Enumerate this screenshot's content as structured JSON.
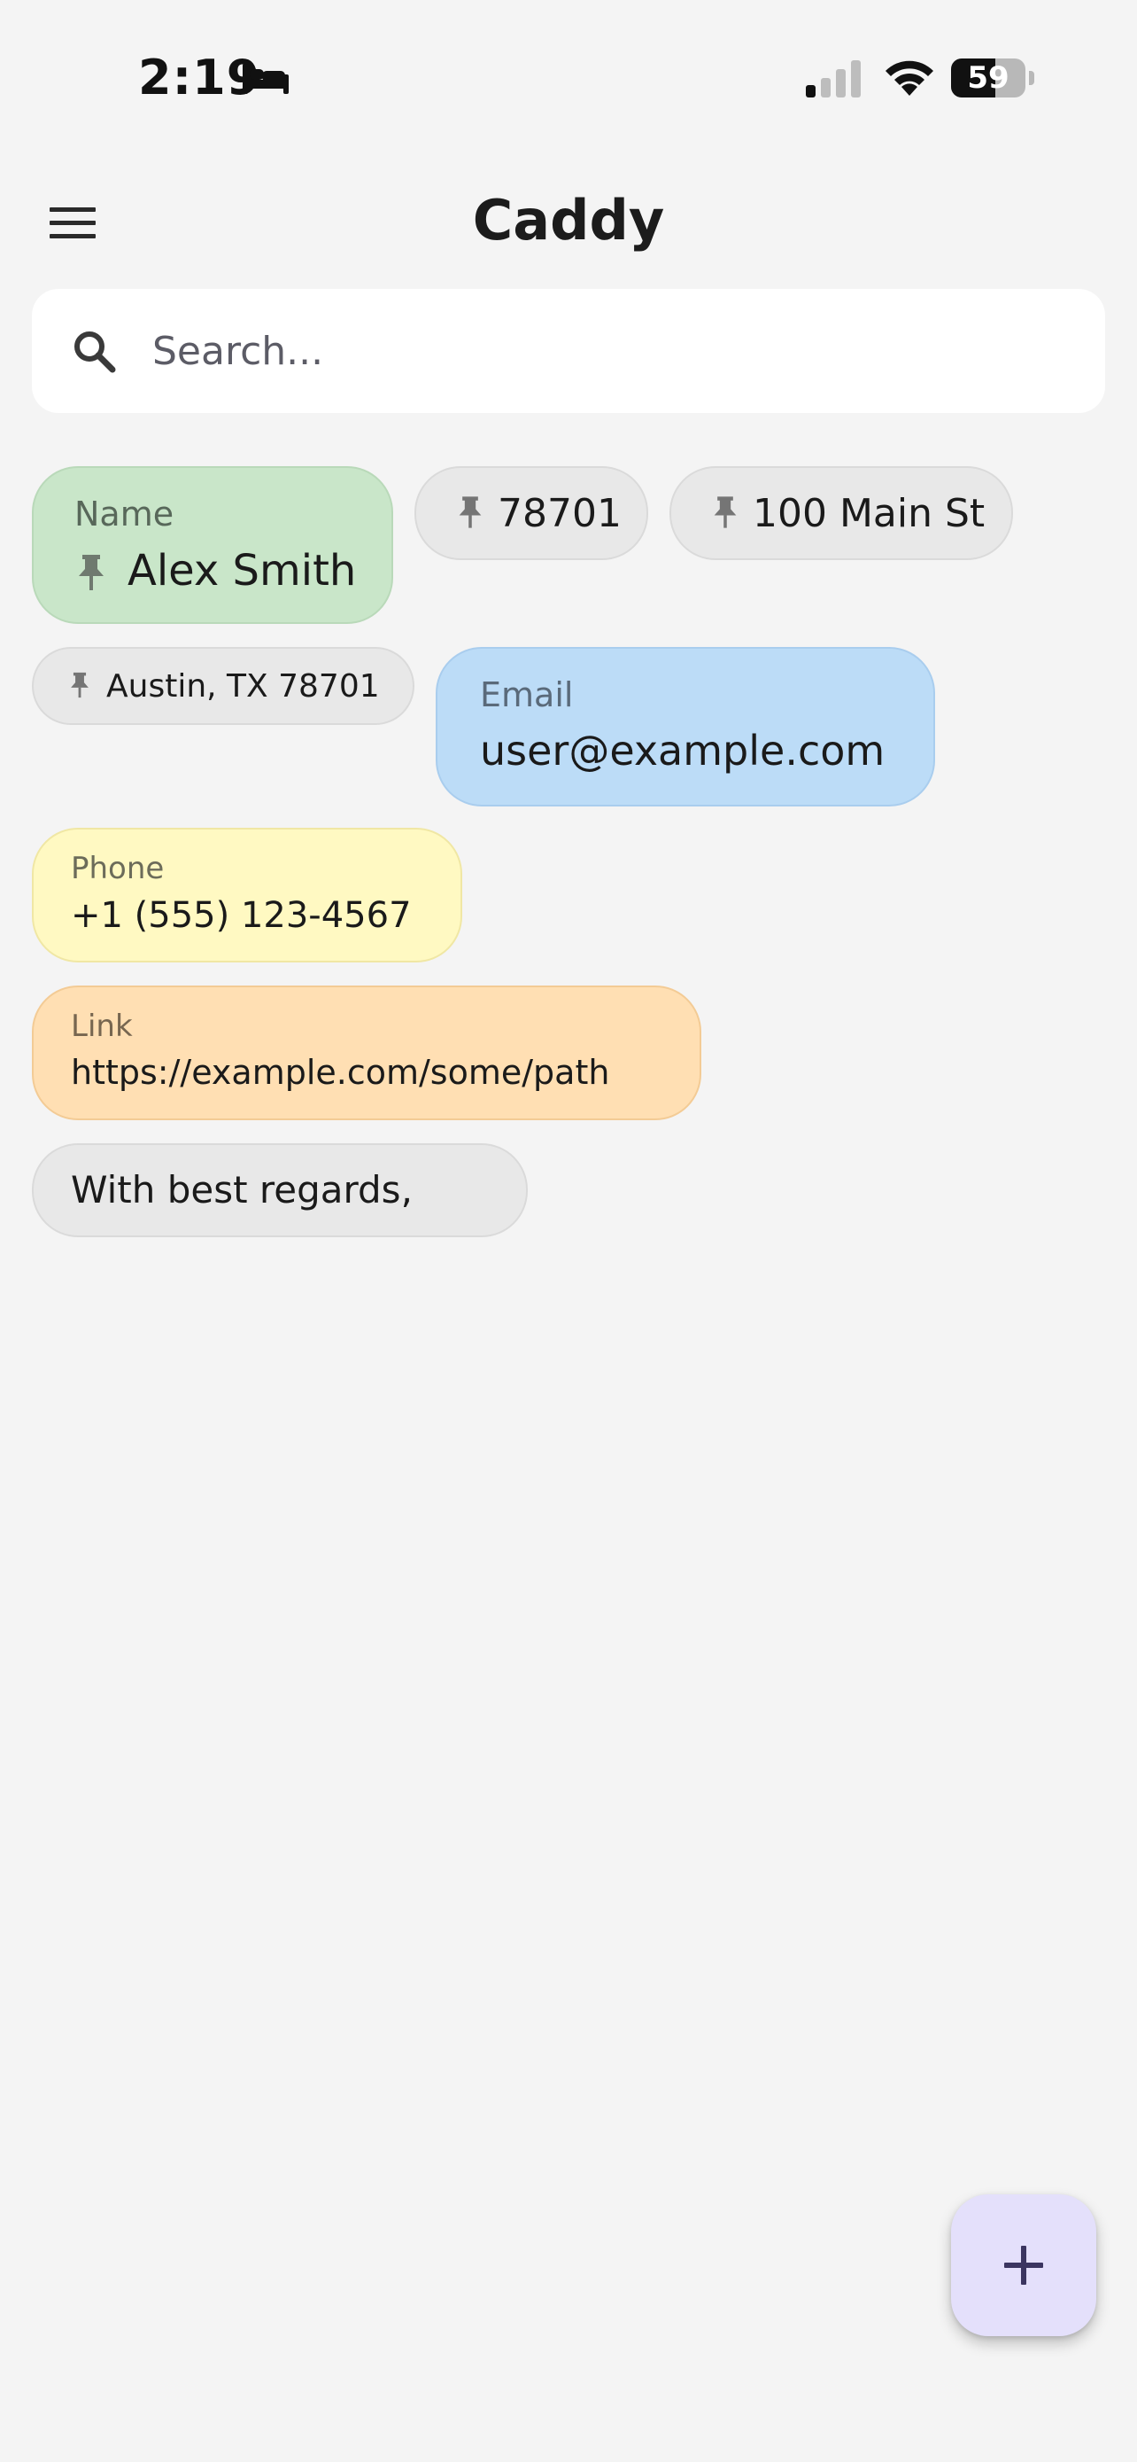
{
  "status_bar": {
    "time": "2:19",
    "battery_percent": 59,
    "battery_text": "59",
    "signal_bars_active": 1,
    "signal_bars_total": 4
  },
  "app_bar": {
    "title": "Caddy",
    "menu_icon": "hamburger-menu-icon"
  },
  "search": {
    "placeholder": "Search...",
    "value": "",
    "icon": "search-icon"
  },
  "chips": {
    "name": {
      "label": "Name",
      "value": "Alex Smith",
      "pinned": true,
      "color": "#c9e6c9"
    },
    "zip": {
      "value": "78701",
      "pinned": true,
      "color": "#e8e8e8"
    },
    "street": {
      "value": "100 Main St",
      "pinned": true,
      "color": "#e8e8e8"
    },
    "city": {
      "value": "Austin, TX 78701",
      "pinned": true,
      "color": "#e8e8e8"
    },
    "email": {
      "label": "Email",
      "value": "user@example.com",
      "color": "#bcdcf7"
    },
    "phone": {
      "label": "Phone",
      "value": "+1 (555) 123-4567",
      "color": "#fff9c2"
    },
    "link": {
      "label": "Link",
      "value": "https://example.com/some/path",
      "color": "#ffdfb3"
    },
    "signoff": {
      "value": "With best regards,",
      "color": "#e8e8e8"
    }
  },
  "fab": {
    "icon": "plus-icon",
    "color": "#e4e0fb"
  }
}
